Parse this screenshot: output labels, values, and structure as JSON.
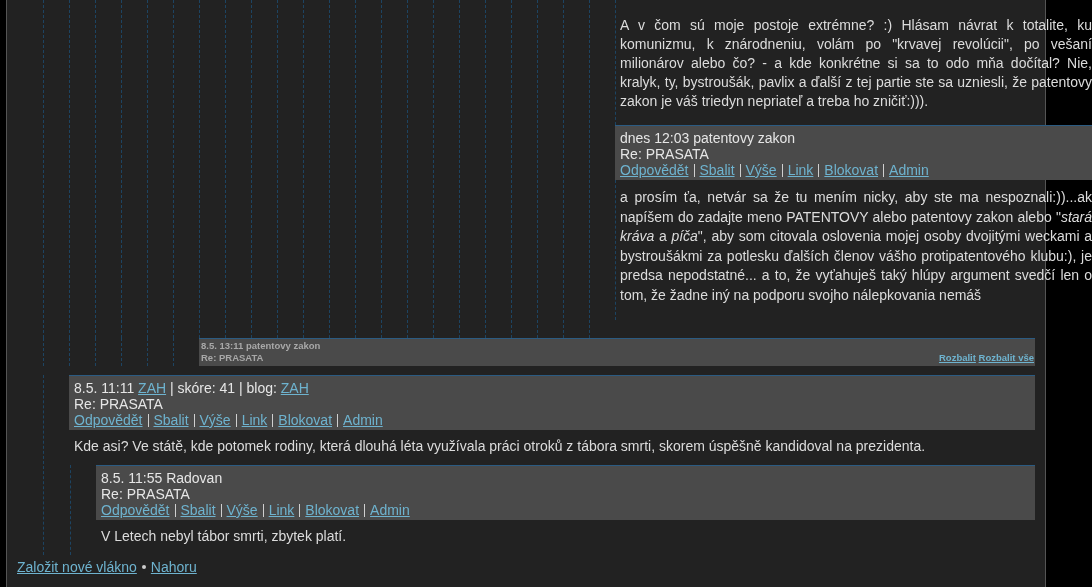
{
  "deep_thread": {
    "fragment": "A v čom sú moje postoje extrémne? :) Hlásam návrat k totalite, ku komunizmu, k znárodneniu, volám po \"krvavej revolúcii\", po vešaní milionárov alebo čo? - a kde konkrétne si  sa to odo mňa dočítal? Nie, kralyk, ty, bystroušák, pavlix a ďalší z tej partie ste sa uzniesli, že patentovy zakon je váš triedyn nepriateľ a treba ho zničiť:))).",
    "reply": {
      "meta": [
        {
          "kind": "text",
          "text": "dnes 12:03 patentovy zakon"
        }
      ],
      "subject": "Re: PRASATA",
      "actions": [
        "Odpovědět",
        "Sbalit",
        "Výše",
        "Link",
        "Blokovat",
        "Admin"
      ],
      "body": "a prosím ťa, netvár sa že tu mením nicky, aby ste ma nespoznali:))...ak napíšem do zadajte meno PATENTOVY alebo patentovy zakon alebo \"*stará kráva* a *píča*\", aby som citovala oslovenia mojej osoby dvojitými weckami a bystroušákmi za potlesku ďalších členov vášho protipatentového klubu:), je predsa nepodstatné... a to, že vyťahuješ taký hlúpy argument svedčí len o tom, že žadne iný na podporu svojho nálepkovania nemáš"
    }
  },
  "collapsed_comment": {
    "header": "8.5. 13:11 patentovy zakon",
    "subject": "Re: PRASATA",
    "actions": [
      "Rozbalit",
      "Rozbalit vše"
    ]
  },
  "comments": [
    {
      "meta": [
        {
          "kind": "text",
          "text": "8.5. 11:11"
        },
        {
          "kind": "link",
          "text": "ZAH"
        },
        {
          "kind": "text",
          "text": "| skóre: 41 | blog:"
        },
        {
          "kind": "link",
          "text": "ZAH"
        }
      ],
      "subject": "Re: PRASATA",
      "actions": [
        "Odpovědět",
        "Sbalit",
        "Výše",
        "Link",
        "Blokovat",
        "Admin"
      ],
      "body": "Kde asi? Ve státě, kde potomek rodiny, která dlouhá léta využívala práci otroků z tábora smrti, skorem úspěšně kandidoval na prezidenta.",
      "children": [
        {
          "meta": [
            {
              "kind": "text",
              "text": "8.5. 11:55 Radovan"
            }
          ],
          "subject": "Re: PRASATA",
          "actions": [
            "Odpovědět",
            "Sbalit",
            "Výše",
            "Link",
            "Blokovat",
            "Admin"
          ],
          "body": "V Letech nebyl tábor smrti, zbytek platí."
        }
      ]
    }
  ],
  "footer_links": [
    "Založit nové vlákno",
    "Nahoru"
  ]
}
